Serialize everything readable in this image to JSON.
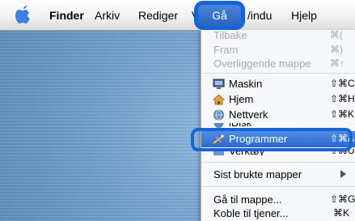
{
  "menubar": {
    "apple_icon": "apple-icon",
    "items": [
      "Finder",
      "Arkiv",
      "Rediger",
      "Vi",
      "Gå",
      "Vindu",
      "Hjelp"
    ],
    "vindu_visible": "/indu"
  },
  "go_menu": {
    "items": [
      {
        "label": "Tilbake",
        "shortcut": "⌘(",
        "enabled": false
      },
      {
        "label": "Fram",
        "shortcut": "⌘)",
        "enabled": false
      },
      {
        "label": "Overliggende mappe",
        "shortcut": "⌘↑",
        "enabled": false
      },
      {
        "label": "Maskin",
        "shortcut": "⇧⌘C",
        "icon": "computer-icon",
        "enabled": true
      },
      {
        "label": "Hjem",
        "shortcut": "⇧⌘H",
        "icon": "home-icon",
        "enabled": true
      },
      {
        "label": "Nettverk",
        "shortcut": "⇧⌘K",
        "icon": "network-icon",
        "enabled": true
      },
      {
        "label": "iDisk",
        "shortcut": "",
        "icon": "idisk-icon",
        "enabled": true,
        "partially_hidden": true
      },
      {
        "label": "Programmer",
        "shortcut": "⇧⌘A",
        "icon": "applications-icon",
        "enabled": true,
        "selected": true
      },
      {
        "label": "Verktøy",
        "shortcut": "⇧⌘U",
        "icon": "utilities-icon",
        "enabled": true,
        "partially_hidden": true
      },
      {
        "label": "Sist brukte mapper",
        "submenu": true,
        "enabled": true
      },
      {
        "label": "Gå til mappe...",
        "shortcut": "⇧⌘G",
        "enabled": true
      },
      {
        "label": "Koble til tjener...",
        "shortcut": "⌘K",
        "enabled": true
      }
    ]
  },
  "colors": {
    "highlight": "#2b67cf",
    "callout": "#1565d8"
  }
}
